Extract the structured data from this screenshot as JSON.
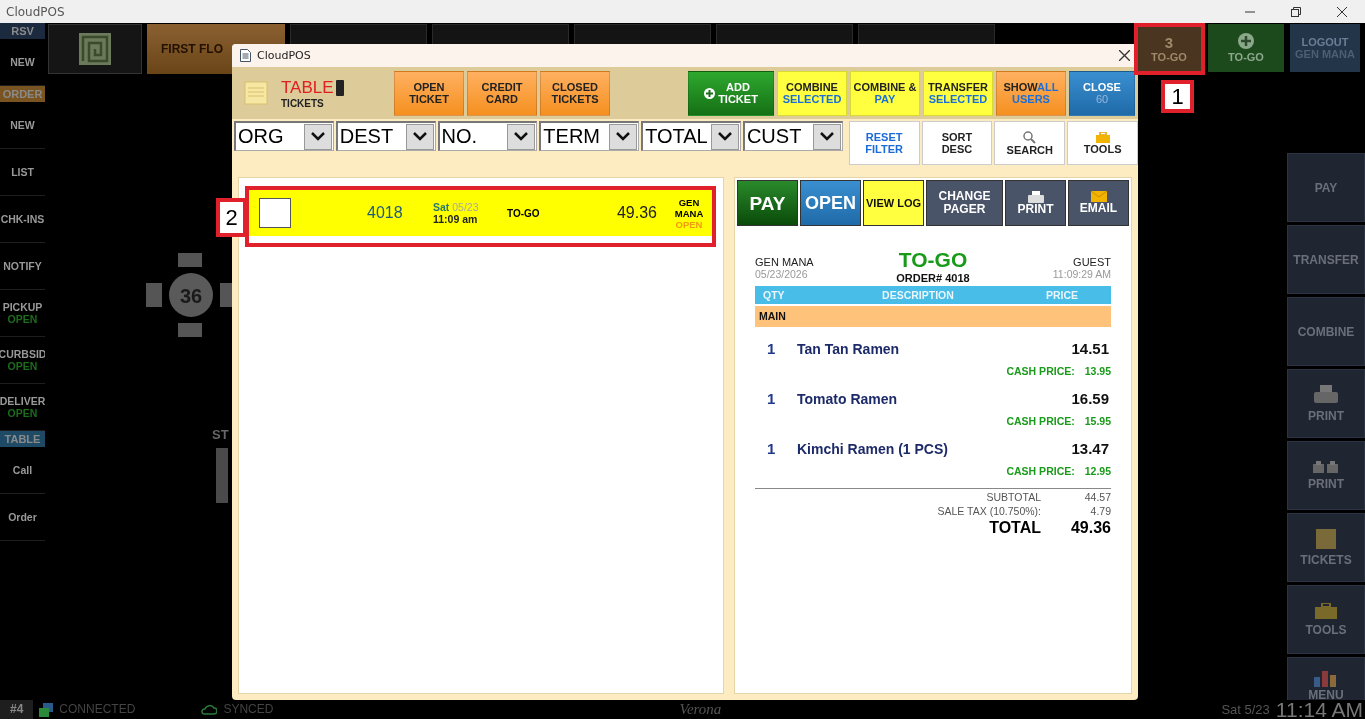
{
  "app_title": "CloudPOS",
  "sidebar": [
    {
      "kind": "header",
      "label": "RSV",
      "color": "#1c2a40"
    },
    {
      "kind": "item",
      "label": "NEW"
    },
    {
      "kind": "header",
      "label": "ORDER",
      "color": "#7a5420"
    },
    {
      "kind": "item",
      "label": "NEW"
    },
    {
      "kind": "item",
      "label": "LIST"
    },
    {
      "kind": "item",
      "label": "CHK-INS"
    },
    {
      "kind": "item",
      "label": "NOTIFY"
    },
    {
      "kind": "item",
      "label": "PICKUP",
      "status": "OPEN"
    },
    {
      "kind": "item",
      "label": "CURBSID",
      "status": "OPEN"
    },
    {
      "kind": "item",
      "label": "DELIVER",
      "status": "OPEN"
    },
    {
      "kind": "header",
      "label": "TABLE",
      "color": "#1f4a66"
    },
    {
      "kind": "item",
      "label": "Call"
    },
    {
      "kind": "item",
      "label": "Order"
    }
  ],
  "floor_tab": {
    "label": "FIRST FLO",
    "selected": true
  },
  "top_right": [
    {
      "kind": "count",
      "count": "3",
      "label": "TO-GO"
    },
    {
      "kind": "add",
      "label": "TO-GO"
    },
    {
      "kind": "logout",
      "label": "LOGOUT",
      "sub": "GEN MANA"
    }
  ],
  "floor": {
    "table_number": "36",
    "partial_label": "ST"
  },
  "right_sidebar": [
    {
      "kind": "text",
      "label": "PAY"
    },
    {
      "kind": "text",
      "label": "TRANSFER"
    },
    {
      "kind": "text",
      "label": "COMBINE"
    },
    {
      "kind": "printer",
      "label": "PRINT"
    },
    {
      "kind": "multi",
      "label": "PRINT"
    },
    {
      "kind": "tickets",
      "label": "TICKETS"
    },
    {
      "kind": "tools",
      "label": "TOOLS"
    },
    {
      "kind": "menu",
      "label": "MENU"
    }
  ],
  "dialog": {
    "title": "CloudPOS",
    "heading": "TABLE",
    "subheading": "TICKETS",
    "toolbar": [
      {
        "kind": "orange",
        "lines": [
          [
            {
              "text": "OPEN"
            }
          ],
          [
            {
              "text": "TICKET"
            }
          ]
        ]
      },
      {
        "kind": "orange",
        "lines": [
          [
            {
              "text": "CREDIT"
            }
          ],
          [
            {
              "text": "CARD"
            }
          ]
        ]
      },
      {
        "kind": "orange",
        "lines": [
          [
            {
              "text": "CLOSED"
            }
          ],
          [
            {
              "text": "TICKETS"
            }
          ]
        ]
      },
      {
        "kind": "green",
        "lines": [
          [
            {
              "text": "ADD"
            }
          ],
          [
            {
              "text": "TICKET"
            }
          ]
        ]
      },
      {
        "kind": "yellow",
        "lines": [
          [
            {
              "text": "COMBINE"
            }
          ],
          [
            {
              "text": "SELECTED",
              "accent": true
            }
          ]
        ]
      },
      {
        "kind": "yellow",
        "lines": [
          [
            {
              "text": "COMBINE &"
            }
          ],
          [
            {
              "text": "PAY",
              "accent": true
            }
          ]
        ]
      },
      {
        "kind": "yellow",
        "lines": [
          [
            {
              "text": "TRANSFER"
            }
          ],
          [
            {
              "text": "SELECTED",
              "accent": true
            }
          ]
        ]
      },
      {
        "kind": "orange",
        "lines": [
          [
            {
              "text": "SHOW"
            },
            {
              "text": "ALL",
              "accent": true
            }
          ],
          [
            {
              "text": "USERS",
              "accent": true
            }
          ]
        ]
      },
      {
        "kind": "blue",
        "lines": [
          [
            {
              "text": "CLOSE"
            }
          ],
          [
            {
              "text": "60",
              "accent": true
            }
          ]
        ]
      }
    ],
    "filters": [
      "ORG",
      "DEST",
      "NO.",
      "TERM",
      "TOTAL",
      "CUST"
    ],
    "filter_buttons": [
      {
        "kind": "reset",
        "lines": [
          "RESET",
          "FILTER"
        ]
      },
      {
        "kind": "sort",
        "lines": [
          "SORT",
          "DESC"
        ]
      },
      {
        "kind": "search",
        "lines": [
          "SEARCH"
        ]
      },
      {
        "kind": "tools",
        "lines": [
          "TOOLS"
        ]
      }
    ],
    "tickets": [
      {
        "checked": false,
        "selected": true,
        "number": "4018",
        "day": "Sat",
        "date": "05/23",
        "time": "11:09 am",
        "type": "TO-GO",
        "total": "49.36",
        "user": "GEN MANA",
        "status": "OPEN"
      }
    ],
    "actions": [
      {
        "kind": "pay",
        "label": "PAY"
      },
      {
        "kind": "open",
        "label": "OPEN"
      },
      {
        "kind": "log",
        "label": "VIEW LOG"
      },
      {
        "kind": "pager",
        "label": "CHANGE PAGER"
      },
      {
        "kind": "print",
        "label": "PRINT"
      },
      {
        "kind": "email",
        "label": "EMAIL"
      }
    ],
    "receipt": {
      "server": "GEN MANA",
      "date": "05/23/2026",
      "type": "TO-GO",
      "order": "ORDER# 4018",
      "customer": "GUEST",
      "time": "11:09:29 AM",
      "columns": [
        "QTY",
        "DESCRIPTION",
        "PRICE"
      ],
      "section": "MAIN",
      "items": [
        {
          "qty": "1",
          "name": "Tan Tan Ramen",
          "price": "14.51",
          "cash_label": "CASH PRICE:",
          "cash_price": "13.95"
        },
        {
          "qty": "1",
          "name": "Tomato Ramen",
          "price": "16.59",
          "cash_label": "CASH PRICE:",
          "cash_price": "15.95"
        },
        {
          "qty": "1",
          "name": "Kimchi Ramen (1 PCS)",
          "price": "13.47",
          "cash_label": "CASH PRICE:",
          "cash_price": "12.95"
        }
      ],
      "subtotal_label": "SUBTOTAL",
      "subtotal": "44.57",
      "tax_label": "SALE TAX (10.750%):",
      "tax": "4.79",
      "total_label": "TOTAL",
      "total": "49.36"
    }
  },
  "status_bar": {
    "terminal": "#4",
    "connection": "CONNECTED",
    "sync": "SYNCED",
    "location": "Verona",
    "date": "Sat 5/23",
    "time": "11:14 AM"
  },
  "callouts": [
    {
      "label": "1"
    },
    {
      "label": "2"
    }
  ]
}
